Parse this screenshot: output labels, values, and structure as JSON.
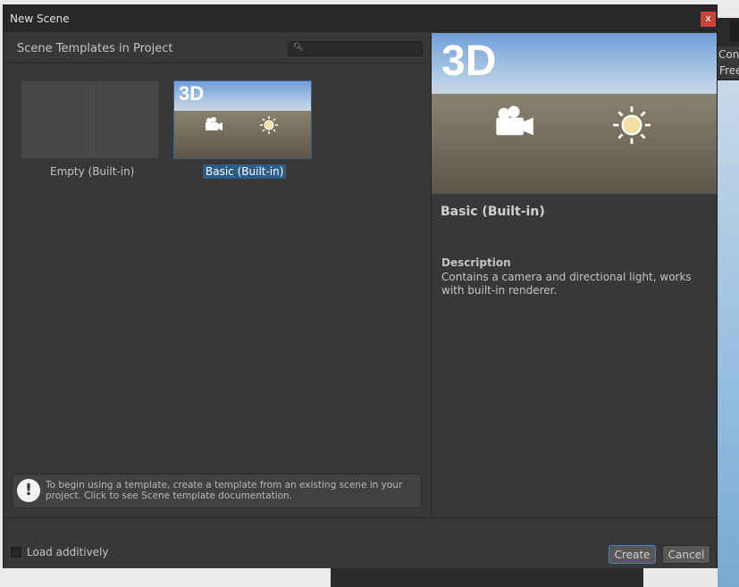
{
  "background": {
    "right_tab1": "Con",
    "right_tab2": "Free"
  },
  "dialog": {
    "title": "New Scene",
    "close_label": "x"
  },
  "left_pane": {
    "header": "Scene Templates in Project",
    "search_placeholder": "",
    "search_icon": "search-icon",
    "templates": [
      {
        "label": "Empty (Built-in)",
        "selected": false
      },
      {
        "label": "Basic (Built-in)",
        "selected": true,
        "thumb_text": "3D"
      }
    ],
    "info": {
      "icon": "!",
      "text": "To begin using a template, create a template from an existing scene in your project. Click to see Scene template documentation."
    }
  },
  "right_pane": {
    "preview_text": "3D",
    "name": "Basic (Built-in)",
    "description_label": "Description",
    "description": "Contains a camera and directional light, works with built-in renderer."
  },
  "footer": {
    "load_additively": "Load additively",
    "load_additively_checked": false,
    "create": "Create",
    "cancel": "Cancel"
  },
  "colors": {
    "selection": "#2c5d87",
    "close": "#c8433b",
    "accent_border": "#4b7ec6"
  }
}
